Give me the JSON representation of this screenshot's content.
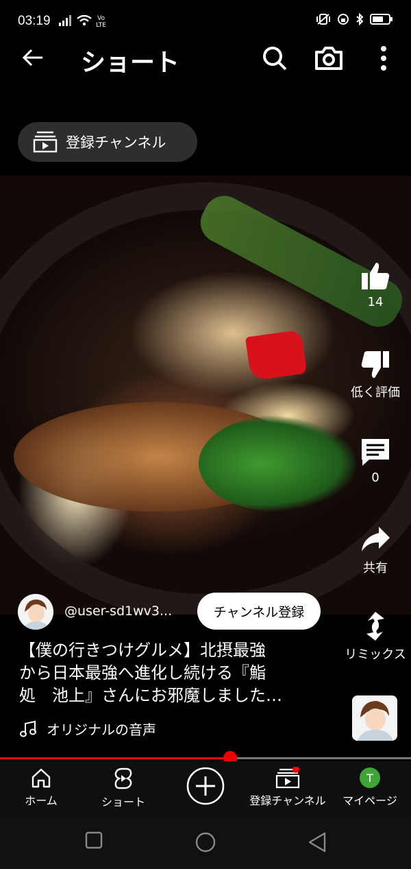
{
  "status_bar": {
    "time": "03:19"
  },
  "header": {
    "title": "ショート"
  },
  "subscriptions_pill": {
    "label": "登録チャンネル"
  },
  "actions": {
    "like_count": "14",
    "dislike_label": "低く評価",
    "comment_count": "0",
    "share_label": "共有",
    "remix_label": "リミックス"
  },
  "channel": {
    "handle": "@user-sd1wv3...",
    "subscribe_label": "チャンネル登録"
  },
  "video": {
    "title_line1": "【僕の行きつけグルメ】北摂最強",
    "title_line2": "から日本最強へ進化し続ける『鮨",
    "title_line3": "処　池上』さんにお邪魔しました…",
    "sound_label": "オリジナルの音声",
    "progress_fraction": 0.56
  },
  "bottom_nav": {
    "items": [
      {
        "label": "ホーム",
        "icon": "home-icon"
      },
      {
        "label": "ショート",
        "icon": "shorts-icon"
      },
      {
        "label": "",
        "icon": "create-icon"
      },
      {
        "label": "登録チャンネル",
        "icon": "subscriptions-icon"
      },
      {
        "label": "マイページ",
        "icon": "avatar-icon",
        "avatar_letter": "T"
      }
    ]
  },
  "colors": {
    "accent": "#ff0000",
    "avatar_green": "#3fa535"
  }
}
